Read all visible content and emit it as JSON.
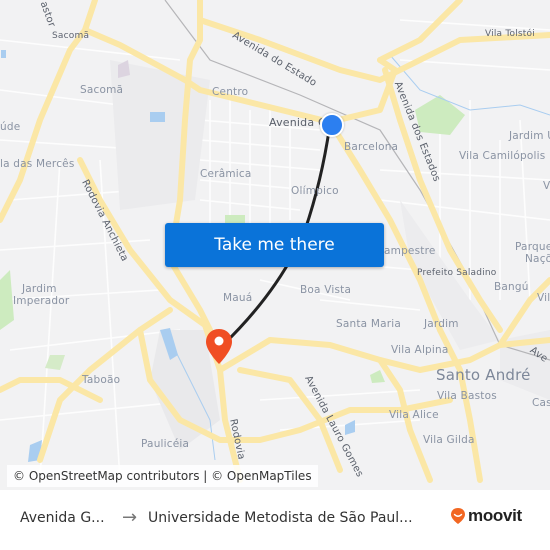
{
  "map": {
    "labels": [
      {
        "text": "Sacomã",
        "cls": "small"
      },
      {
        "text": "Sacomã",
        "cls": ""
      },
      {
        "text": "úde",
        "cls": ""
      },
      {
        "text": "la das Mercês",
        "cls": ""
      },
      {
        "text": "Centro",
        "cls": ""
      },
      {
        "text": "Avenida G",
        "cls": "dark"
      },
      {
        "text": "Barcelona",
        "cls": ""
      },
      {
        "text": "Cerâmica",
        "cls": ""
      },
      {
        "text": "Olímpico",
        "cls": ""
      },
      {
        "text": "Vila Tolstói",
        "cls": "small"
      },
      {
        "text": "Jardim U",
        "cls": ""
      },
      {
        "text": "Vila Camilópolis",
        "cls": ""
      },
      {
        "text": "ampestre",
        "cls": ""
      },
      {
        "text": "Prefeito Saladino",
        "cls": "small"
      },
      {
        "text": "Parque",
        "cls": ""
      },
      {
        "text": "Naçõ",
        "cls": ""
      },
      {
        "text": "Bangú",
        "cls": ""
      },
      {
        "text": "Jardim",
        "cls": ""
      },
      {
        "text": "Jardim",
        "cls": ""
      },
      {
        "text": "Imperador",
        "cls": ""
      },
      {
        "text": "Mauá",
        "cls": ""
      },
      {
        "text": "Boa Vista",
        "cls": ""
      },
      {
        "text": "Santa Maria",
        "cls": ""
      },
      {
        "text": "Vila Alpina",
        "cls": ""
      },
      {
        "text": "Santo André",
        "cls": "big"
      },
      {
        "text": "Vila Bastos",
        "cls": ""
      },
      {
        "text": "Vila Alice",
        "cls": ""
      },
      {
        "text": "Vila Gilda",
        "cls": ""
      },
      {
        "text": "Taboão",
        "cls": ""
      },
      {
        "text": "Paulicéia",
        "cls": ""
      },
      {
        "text": "Cas",
        "cls": ""
      },
      {
        "text": "Vil",
        "cls": ""
      },
      {
        "text": "V",
        "cls": ""
      }
    ],
    "road_labels": [
      {
        "text": "astor"
      },
      {
        "text": "Avenida do Estado"
      },
      {
        "text": "Avenida dos Estados"
      },
      {
        "text": "Rodovia Anchieta"
      },
      {
        "text": "Avenida Lauro Gomes"
      },
      {
        "text": "Rodovia"
      },
      {
        "text": "Ave"
      }
    ],
    "cta_label": "Take me there",
    "attribution": "© OpenStreetMap contributors | © OpenMapTiles",
    "colors": {
      "origin": "#2c7ff0",
      "destination": "#f04e23",
      "route": "#222222",
      "cta": "#0a73d9"
    }
  },
  "footer": {
    "from": "Avenida G...",
    "arrow": "→",
    "to": "Universidade Metodista de São Paul...",
    "brand": "moovit",
    "brand_color": "#f26722"
  }
}
